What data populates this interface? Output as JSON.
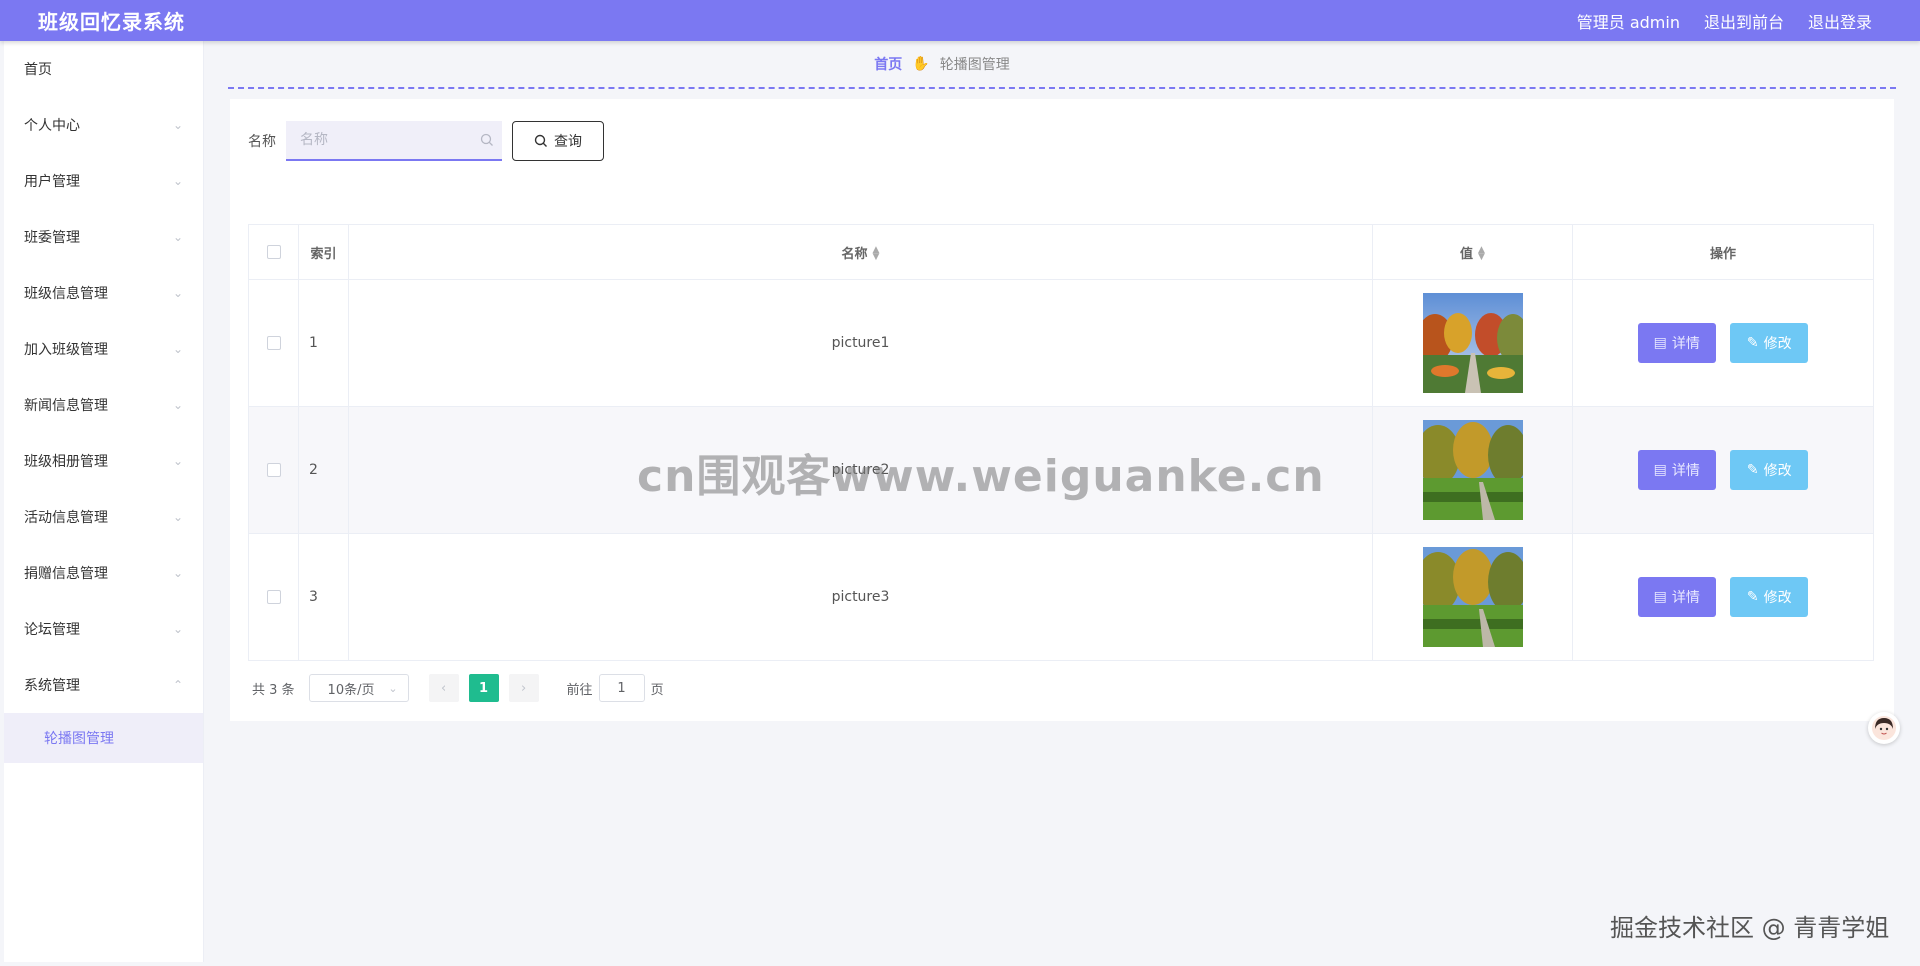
{
  "header": {
    "title": "班级回忆录系统",
    "admin": "管理员 admin",
    "to_front": "退出到前台",
    "logout": "退出登录"
  },
  "sidebar": {
    "items": [
      {
        "label": "首页",
        "chevron": false
      },
      {
        "label": "个人中心",
        "chevron": true
      },
      {
        "label": "用户管理",
        "chevron": true
      },
      {
        "label": "班委管理",
        "chevron": true
      },
      {
        "label": "班级信息管理",
        "chevron": true
      },
      {
        "label": "加入班级管理",
        "chevron": true
      },
      {
        "label": "新闻信息管理",
        "chevron": true
      },
      {
        "label": "班级相册管理",
        "chevron": true
      },
      {
        "label": "活动信息管理",
        "chevron": true
      },
      {
        "label": "捐赠信息管理",
        "chevron": true
      },
      {
        "label": "论坛管理",
        "chevron": true
      },
      {
        "label": "系统管理",
        "chevron": true,
        "expanded": true
      }
    ],
    "sub_item": "轮播图管理"
  },
  "breadcrumb": {
    "home": "首页",
    "current": "轮播图管理"
  },
  "search": {
    "label": "名称",
    "placeholder": "名称",
    "button": "查询"
  },
  "table": {
    "columns": {
      "index": "索引",
      "name": "名称",
      "value": "值",
      "actions": "操作"
    },
    "rows": [
      {
        "index": "1",
        "name": "picture1",
        "image": "campus-autumn-path"
      },
      {
        "index": "2",
        "name": "picture2",
        "image": "campus-lawn-trees"
      },
      {
        "index": "3",
        "name": "picture3",
        "image": "campus-lawn-trees"
      }
    ],
    "detail_label": "详情",
    "edit_label": "修改"
  },
  "pagination": {
    "total": "共 3 条",
    "page_size": "10条/页",
    "current_page": "1",
    "goto_label": "前往",
    "goto_value": "1",
    "page_suffix": "页"
  },
  "overlays": {
    "watermark": "cn围观客www.weiguanke.cn",
    "credit": "掘金技术社区 @ 青青学姐"
  },
  "colors": {
    "primary": "#7b78f2",
    "edit": "#6ec8f5",
    "page_active": "#1fbc8f"
  }
}
